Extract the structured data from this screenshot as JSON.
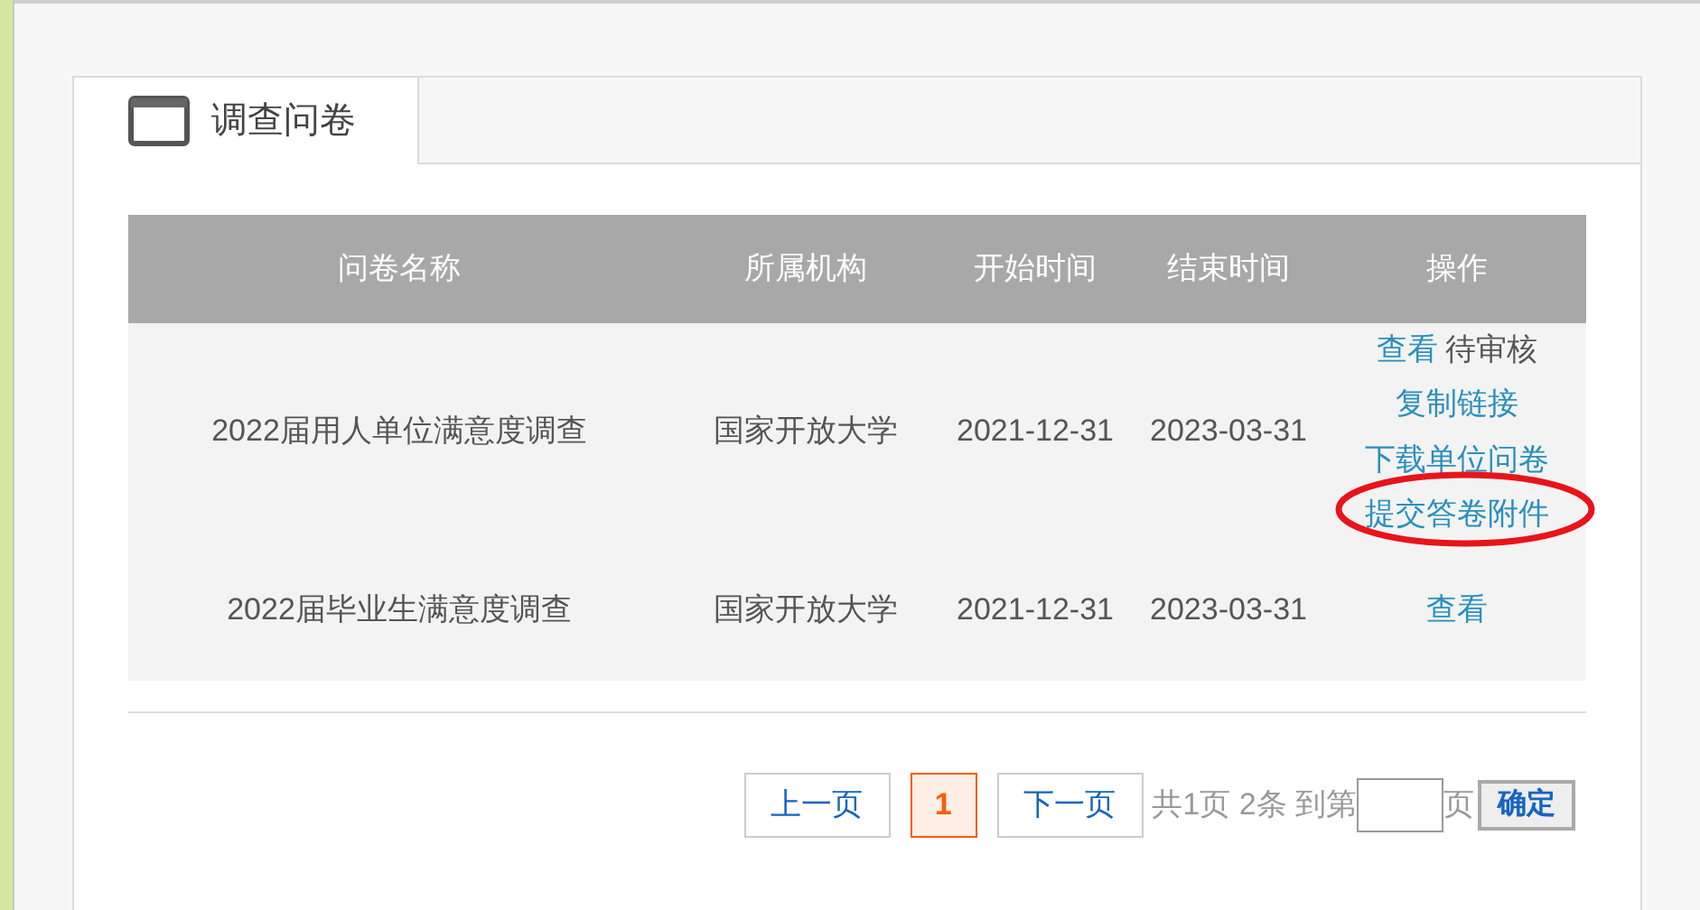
{
  "tab": {
    "label": "调查问卷",
    "selected": true
  },
  "table": {
    "columns": [
      "问卷名称",
      "所属机构",
      "开始时间",
      "结束时间",
      "操作"
    ],
    "rows": [
      {
        "name": "2022届用人单位满意度调查",
        "org": "国家开放大学",
        "start": "2021-12-31",
        "end": "2023-03-31",
        "actions": [
          [
            {
              "kind": "link",
              "text": "查看",
              "circled": false
            },
            {
              "kind": "text",
              "text": "待审核",
              "circled": false
            }
          ],
          [
            {
              "kind": "link",
              "text": "复制链接",
              "circled": false
            }
          ],
          [
            {
              "kind": "link",
              "text": "下载单位问卷",
              "circled": false
            }
          ],
          [
            {
              "kind": "link",
              "text": "提交答卷附件",
              "circled": true
            }
          ]
        ]
      },
      {
        "name": "2022届毕业生满意度调查",
        "org": "国家开放大学",
        "start": "2021-12-31",
        "end": "2023-03-31",
        "actions": [
          [
            {
              "kind": "link",
              "text": "查看",
              "circled": false
            }
          ]
        ]
      }
    ]
  },
  "pagination": {
    "prev": "上一页",
    "pages": [
      {
        "label": "1",
        "selected": true
      }
    ],
    "next": "下一页",
    "summary": "共1页 2条 到第",
    "page_suffix": "页",
    "confirm": "确定"
  }
}
